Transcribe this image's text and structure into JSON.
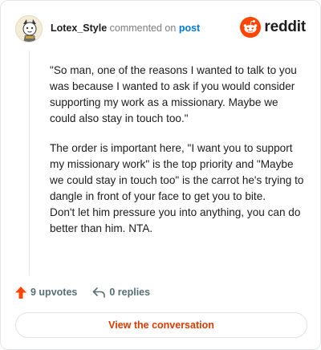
{
  "header": {
    "username": "Lotex_Style",
    "commented_text": "commented on",
    "post_link": "post",
    "brand": "reddit"
  },
  "comment": {
    "paragraph1": "\"So man, one of the reasons I wanted to talk to you was because I wanted to ask if you would consider supporting my work as a missionary. Maybe we could also stay in touch too.\"",
    "paragraph2": "The order is important here, \"I want you to support my missionary work\" is the top priority and \"Maybe we could stay in touch too\" is the carrot he's trying to dangle in front of your face to get you to bite.",
    "paragraph3": "Don't let him pressure you into anything, you can do better than him. NTA."
  },
  "actions": {
    "upvotes": "9 upvotes",
    "replies": "0 replies"
  },
  "footer": {
    "button_label": "View the conversation"
  },
  "colors": {
    "accent": "#ff4500",
    "link": "#0079d3",
    "button_text": "#d93a00"
  }
}
